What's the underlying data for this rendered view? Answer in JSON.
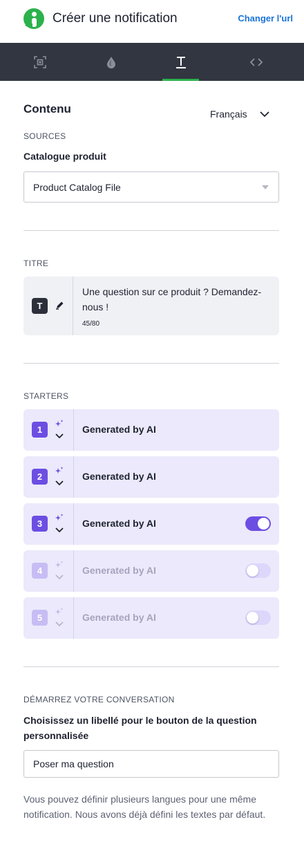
{
  "header": {
    "title": "Créer une notification",
    "change_url": "Changer l'url"
  },
  "tabs": [
    {
      "icon": "frame-icon",
      "active": false
    },
    {
      "icon": "drop-icon",
      "active": false
    },
    {
      "icon": "text-icon",
      "active": true
    },
    {
      "icon": "code-icon",
      "active": false
    }
  ],
  "content": {
    "section_title": "Contenu",
    "language": "Français",
    "sources_caption": "SOURCES",
    "catalog_label": "Catalogue produit",
    "catalog_value": "Product Catalog File"
  },
  "titre": {
    "caption": "TITRE",
    "badge": "T",
    "text": "Une question sur ce produit ? Demandez-nous !",
    "counter": "45/80"
  },
  "starters": {
    "caption": "STARTERS",
    "items": [
      {
        "number": "1",
        "label": "Generated by AI",
        "toggle": null,
        "disabled": false
      },
      {
        "number": "2",
        "label": "Generated by AI",
        "toggle": null,
        "disabled": false
      },
      {
        "number": "3",
        "label": "Generated by AI",
        "toggle": "on",
        "disabled": false
      },
      {
        "number": "4",
        "label": "Generated by AI",
        "toggle": "off",
        "disabled": true
      },
      {
        "number": "5",
        "label": "Generated by AI",
        "toggle": "off",
        "disabled": true
      }
    ]
  },
  "conversation": {
    "caption": "DÉMARREZ VOTRE CONVERSATION",
    "label": "Choisissez un libellé pour le bouton de la question personnalisée",
    "input_value": "Poser ma question",
    "help": "Vous pouvez définir plusieurs langues pour une même notification. Nous avons déjà défini les textes par défaut."
  },
  "colors": {
    "brand_green": "#2bb24c",
    "accent_purple": "#6c4ee3",
    "tabbar": "#323641",
    "link": "#1a73d9"
  }
}
